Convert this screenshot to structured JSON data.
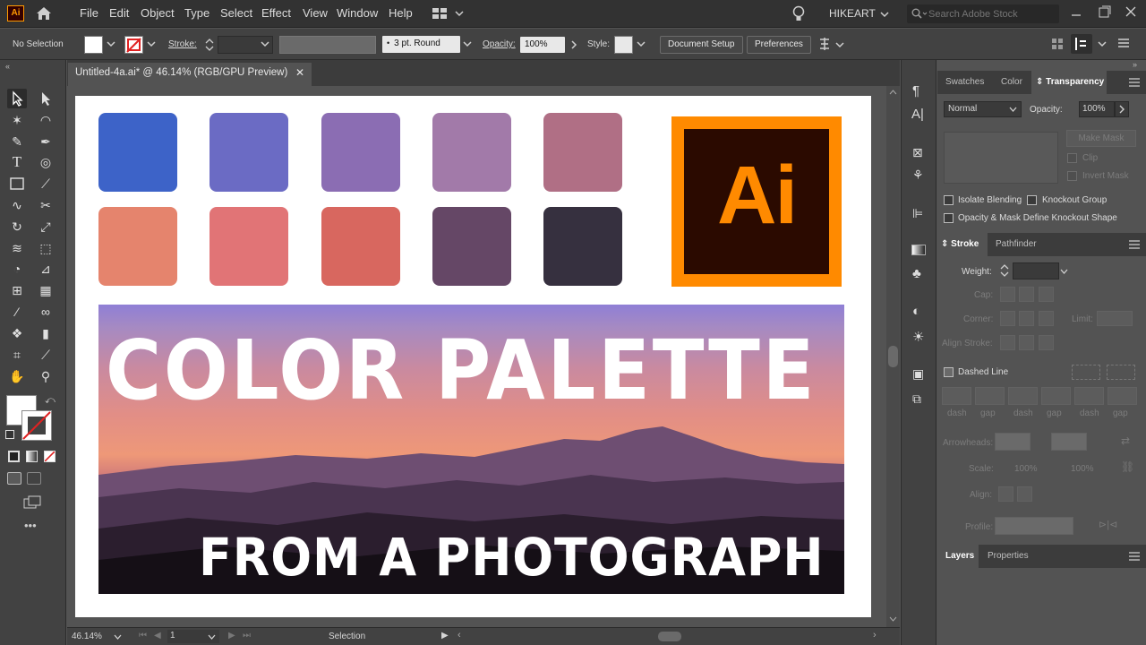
{
  "app": {
    "logo": "Ai",
    "accent": "#ff9a00",
    "logo_bg": "#330000"
  },
  "menu": [
    "File",
    "Edit",
    "Object",
    "Type",
    "Select",
    "Effect",
    "View",
    "Window",
    "Help"
  ],
  "user": "HIKEART",
  "search_placeholder": "Search Adobe Stock",
  "control": {
    "selection": "No Selection",
    "stroke_label": "Stroke:",
    "brush": "3 pt. Round",
    "opacity_label": "Opacity:",
    "opacity": "100%",
    "style_label": "Style:",
    "doc_setup": "Document Setup",
    "preferences": "Preferences"
  },
  "document": {
    "tab": "Untitled-4a.ai* @ 46.14% (RGB/GPU Preview)"
  },
  "artboard": {
    "swatches_row1": [
      "#3d63c8",
      "#6b6bc4",
      "#8b6db3",
      "#a27aa9",
      "#b06f85"
    ],
    "swatches_row2": [
      "#e5846d",
      "#e17476",
      "#d8675f",
      "#654766",
      "#36303f"
    ],
    "title": "COLOR PALETTE",
    "subtitle": "FROM A PHOTOGRAPH",
    "logo_text": "Ai"
  },
  "status": {
    "zoom": "46.14%",
    "artboard": "1",
    "tool": "Selection"
  },
  "transparency": {
    "tabs": [
      "Swatches",
      "Color",
      "Transparency"
    ],
    "blend": "Normal",
    "opacity_label": "Opacity:",
    "opacity": "100%",
    "make_mask": "Make Mask",
    "clip": "Clip",
    "invert_mask": "Invert Mask",
    "isolate": "Isolate Blending",
    "knockout": "Knockout Group",
    "opacity_mask": "Opacity & Mask Define Knockout Shape"
  },
  "stroke": {
    "tabs": [
      "Stroke",
      "Pathfinder"
    ],
    "weight": "Weight:",
    "cap": "Cap:",
    "corner": "Corner:",
    "limit": "Limit:",
    "align": "Align Stroke:",
    "dashed": "Dashed Line",
    "dash_labels": [
      "dash",
      "gap",
      "dash",
      "gap",
      "dash",
      "gap"
    ],
    "arrowheads": "Arrowheads:",
    "scale": "Scale:",
    "scale1": "100%",
    "scale2": "100%",
    "align2": "Align:",
    "profile": "Profile:"
  },
  "layers": {
    "tabs": [
      "Layers",
      "Properties"
    ]
  }
}
